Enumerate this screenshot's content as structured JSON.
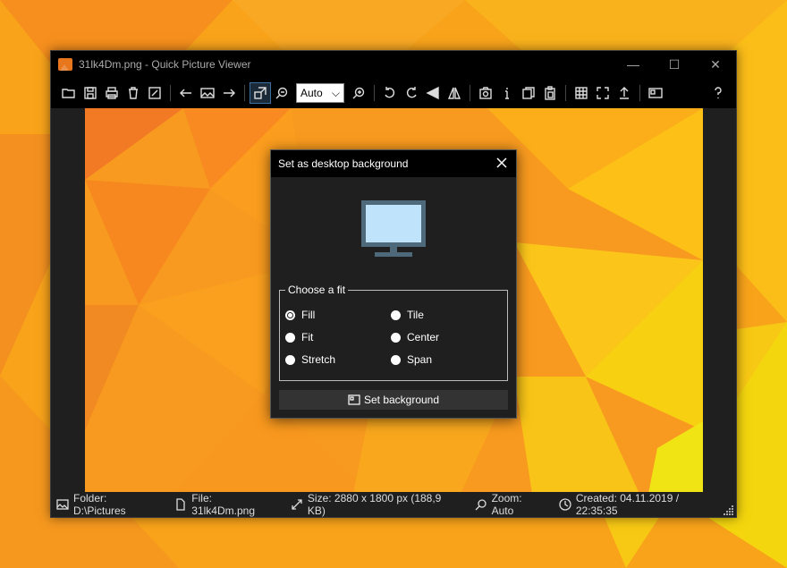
{
  "window": {
    "title": "31lk4Dm.png - Quick Picture Viewer",
    "minimize": "—",
    "maximize": "☐",
    "close": "✕"
  },
  "toolbar": {
    "zoom_value": "Auto",
    "zoom_arrow": "⌵"
  },
  "dialog": {
    "title": "Set as desktop background",
    "group_label": "Choose a fit",
    "options": [
      {
        "label": "Fill",
        "checked": true
      },
      {
        "label": "Fit",
        "checked": false
      },
      {
        "label": "Stretch",
        "checked": false
      },
      {
        "label": "Tile",
        "checked": false
      },
      {
        "label": "Center",
        "checked": false
      },
      {
        "label": "Span",
        "checked": false
      }
    ],
    "button_label": "Set background"
  },
  "status": {
    "folder": "Folder: D:\\Pictures",
    "file": "File: 31lk4Dm.png",
    "size": "Size: 2880 x 1800 px (188,9 KB)",
    "zoom": "Zoom: Auto",
    "created": "Created: 04.11.2019 / 22:35:35"
  },
  "colors": {
    "accent": "#3b6fa0",
    "wallpaper": "#f7a71c"
  }
}
